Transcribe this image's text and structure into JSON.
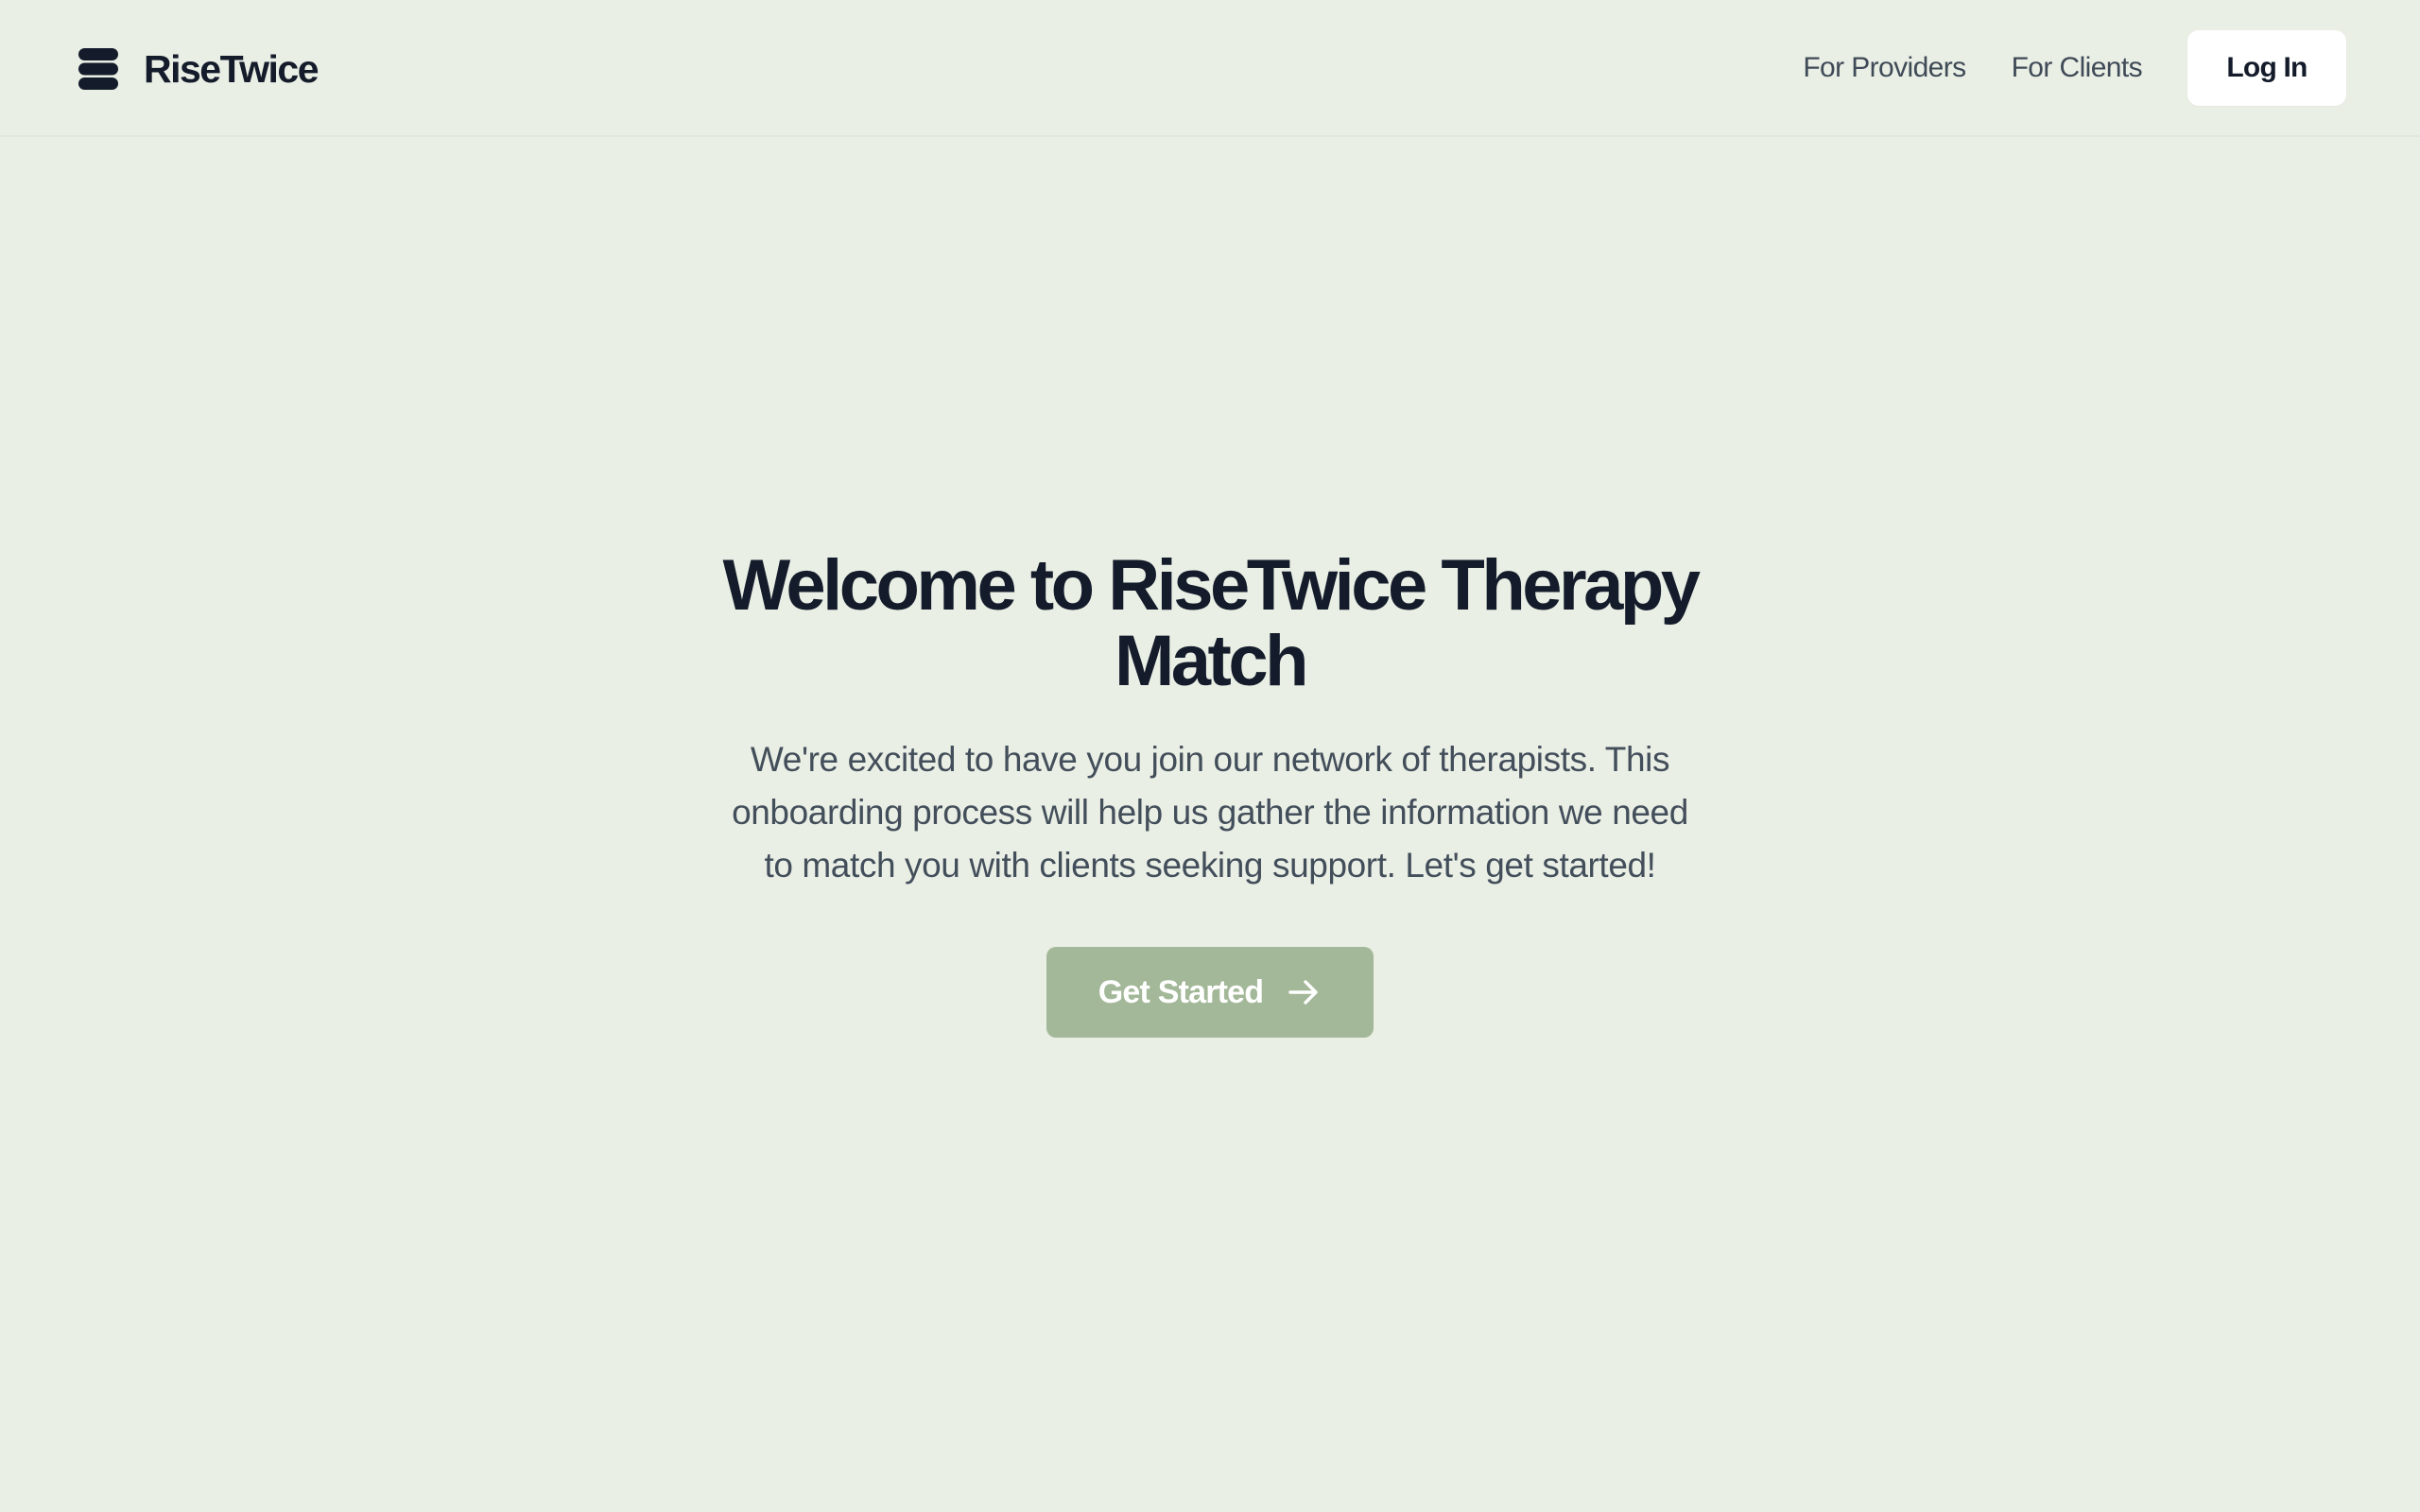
{
  "header": {
    "brand_name": "RiseTwice",
    "brand_icon": "stacked-layers-icon",
    "nav": [
      {
        "label": "For Providers"
      },
      {
        "label": "For Clients"
      }
    ],
    "login_label": "Log In"
  },
  "hero": {
    "title": "Welcome to RiseTwice Therapy Match",
    "description": "We're excited to have you join our network of therapists. This onboarding process will help us gather the information we need to match you with clients seeking support. Let's get started!",
    "cta_label": "Get Started",
    "cta_icon": "arrow-right-icon"
  },
  "colors": {
    "background": "#EAEFE5",
    "text_dark": "#141C2B",
    "text_muted": "#434E5B",
    "cta_background": "#A3B898",
    "login_background": "#FFFFFF"
  }
}
